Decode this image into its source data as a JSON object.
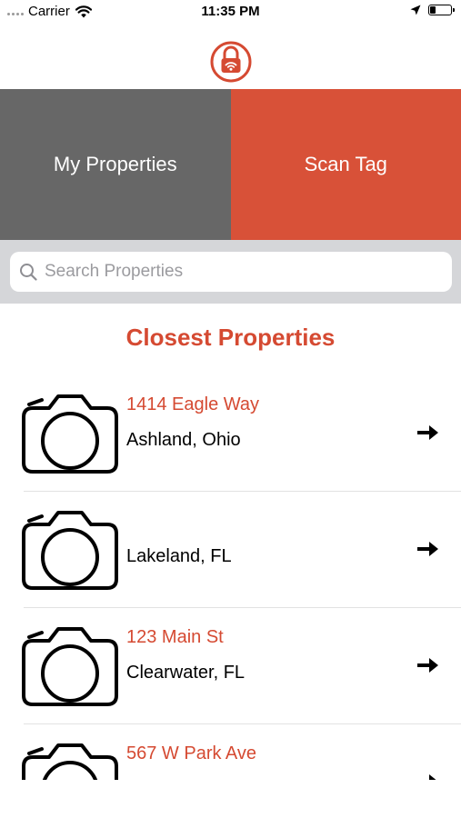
{
  "status_bar": {
    "carrier": "Carrier",
    "time": "11:35 PM",
    "battery_level": 0.25
  },
  "logo": {
    "icon": "padlock-wifi-icon",
    "color": "#d54a32"
  },
  "tiles": {
    "my_properties": {
      "label": "My Properties",
      "color": "#676767"
    },
    "scan_tag": {
      "label": "Scan Tag",
      "color": "#d85138"
    }
  },
  "search": {
    "placeholder": "Search Properties",
    "value": ""
  },
  "section_title": "Closest Properties",
  "properties": [
    {
      "street": "1414 Eagle Way",
      "city": "Ashland, Ohio",
      "icon": "camera-icon"
    },
    {
      "street": "",
      "city": "Lakeland, FL",
      "icon": "camera-icon"
    },
    {
      "street": "123 Main St",
      "city": "Clearwater, FL",
      "icon": "camera-icon"
    },
    {
      "street": "567 W Park Ave",
      "city": "",
      "icon": "camera-icon"
    }
  ],
  "colors": {
    "accent": "#d54a32",
    "tile_gray": "#676767",
    "search_band": "#d5d6d9"
  }
}
